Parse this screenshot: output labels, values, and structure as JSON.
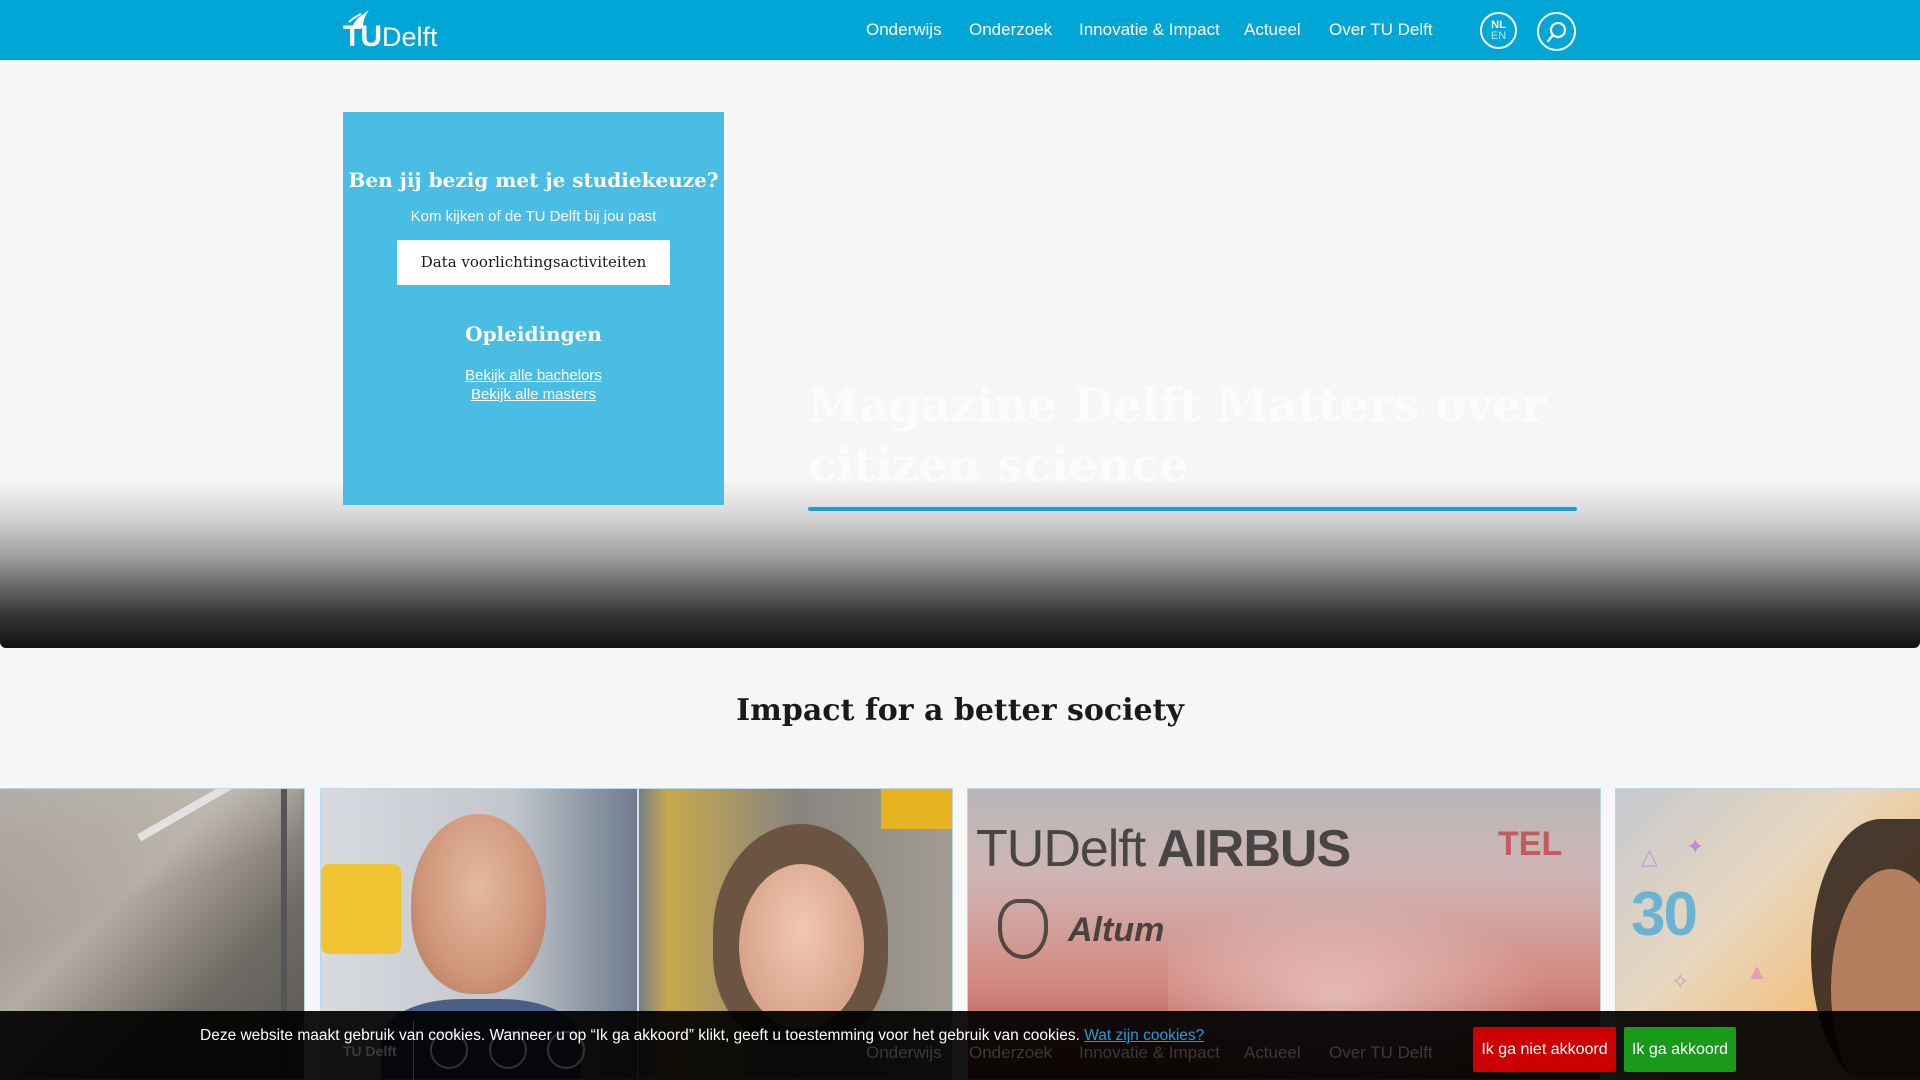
{
  "header": {
    "logo_tu": "TU",
    "logo_delft": "Delft",
    "nav": [
      "Onderwijs",
      "Onderzoek",
      "Innovatie & Impact",
      "Actueel",
      "Over TU Delft"
    ],
    "lang_primary": "NL",
    "lang_secondary": "EN",
    "colors": {
      "bar": "#00a6d6"
    }
  },
  "study_box": {
    "heading": "Ben jij bezig met je studiekeuze?",
    "subtext": "Kom kijken of de TU Delft bij jou past",
    "cta_label": "Data voorlichtingsactiviteiten",
    "programs_heading": "Opleidingen",
    "link_bachelors": "Bekijk alle bachelors",
    "link_masters": "Bekijk alle masters",
    "color": "#49bde3"
  },
  "hero": {
    "title": "Magazine Delft Matters over citizen science"
  },
  "section": {
    "title": "Impact for a better society"
  },
  "cards": {
    "card3_brand_tu": "TU",
    "card3_brand_delft": "Delft",
    "card3_brand_airbus": "AIRBUS",
    "card3_brand_tel": "TEL",
    "card3_altum": "Altum",
    "card4_number": "30"
  },
  "cookie": {
    "message": "Deze website maakt gebruik van cookies. Wanneer u op “Ik ga akkoord” klikt, geeft u toestemming voor het gebruik van cookies.",
    "link_label": "Wat zijn cookies?",
    "decline_label": "Ik ga niet akkoord",
    "accept_label": "Ik ga akkoord",
    "decline_color": "#cc0000",
    "accept_color": "#1a9a1a"
  },
  "footer_ghost": {
    "logo": "TU Delft",
    "nav": [
      "Onderwijs",
      "Onderzoek",
      "Innovatie & Impact",
      "Actueel",
      "Over TU Delft"
    ]
  }
}
